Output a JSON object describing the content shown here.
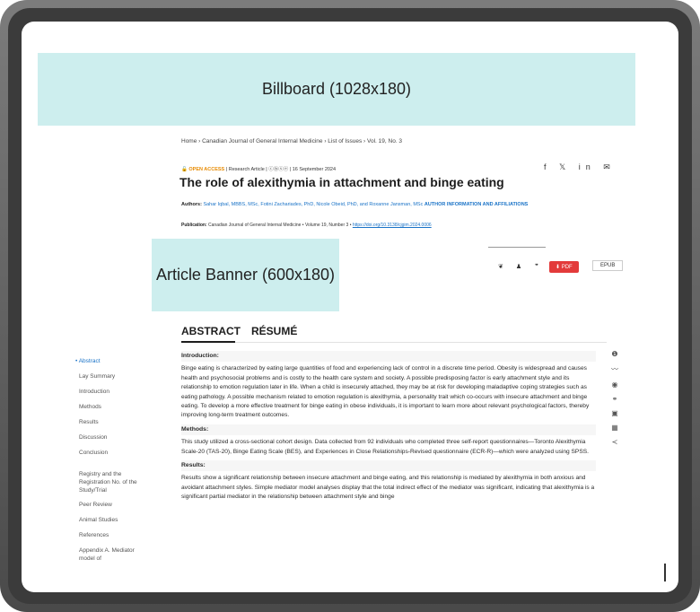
{
  "billboard": {
    "label": "Billboard (1028x180)"
  },
  "banner": {
    "label": "Article Banner (600x180)"
  },
  "breadcrumb": {
    "text": "Home › Canadian Journal of General Internal Medicine › List of Issues › Vol. 19, No. 3"
  },
  "article": {
    "open_access": "OPEN ACCESS",
    "meta": "| Research Article | ⓒⓑⓢⓔ | 16 September 2024",
    "title": "The role of alexithymia in attachment and binge eating",
    "authors_label": "Authors:",
    "authors": "Sahar Iqbal, MBBS, MSc, Fotini Zachariades, PhD, Nicole Obeid, PhD, and Roxanne Jansman, MSc",
    "author_info": "AUTHOR INFORMATION AND AFFILIATIONS",
    "publication_label": "Publication:",
    "publication": "Canadian Journal of General Internal Medicine • Volume 19, Number 3 •",
    "doi": "https://doi.org/10.3138/cjgim.2024.0006"
  },
  "share": {
    "icons": "f 𝕏 in ✉"
  },
  "toolbar": {
    "pdf_label": "PDF",
    "epub_label": "EPUB"
  },
  "tabs": {
    "abstract": "ABSTRACT",
    "resume": "RÉSUMÉ"
  },
  "sidebar": {
    "items": [
      {
        "label": "• Abstract"
      },
      {
        "label": "Lay Summary"
      },
      {
        "label": "Introduction"
      },
      {
        "label": "Methods"
      },
      {
        "label": "Results"
      },
      {
        "label": "Discussion"
      },
      {
        "label": "Conclusion"
      },
      {
        "label": "Registry and the Registration No. of the Study/Trial"
      },
      {
        "label": "Peer Review"
      },
      {
        "label": "Animal Studies"
      },
      {
        "label": "References"
      },
      {
        "label": "Appendix A. Mediator model of"
      }
    ]
  },
  "content": {
    "intro_heading": "Introduction:",
    "intro_text": "Binge eating is characterized by eating large quantities of food and experiencing lack of control in a discrete time period. Obesity is widespread and causes health and psychosocial problems and is costly to the health care system and society. A possible predisposing factor is early attachment style and its relationship to emotion regulation later in life. When a child is insecurely attached, they may be at risk for developing maladaptive coping strategies such as eating pathology. A possible mechanism related to emotion regulation is alexithymia, a personality trait which co-occurs with insecure attachment and binge eating. To develop a more effective treatment for binge eating in obese individuals, it is important to learn more about relevant psychological factors, thereby improving long-term treatment outcomes.",
    "methods_heading": "Methods:",
    "methods_text": "This study utilized a cross-sectional cohort design. Data collected from 92 individuals who completed three self-report questionnaires—Toronto Alexithymia Scale-20 (TAS-20), Binge Eating Scale (BES), and Experiences in Close Relationships-Revised questionnaire (ECR-R)—which were analyzed using SPSS.",
    "results_heading": "Results:",
    "results_text": "Results show a significant relationship between insecure attachment and binge eating, and this relationship is mediated by alexithymia in both anxious and avoidant attachment styles. Simple mediator model analyses display that the total indirect effect of the mediator was significant, indicating that alexithymia is a significant partial mediator in the relationship between attachment style and binge"
  }
}
